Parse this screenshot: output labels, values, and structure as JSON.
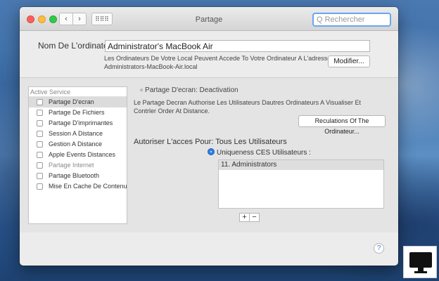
{
  "window": {
    "title": "Partage",
    "search_placeholder": "Q Rechercher"
  },
  "nav": {
    "back": "‹",
    "forward": "›",
    "grid": "⠿⠿⠿"
  },
  "computer_name": {
    "label": "Nom De L'ordinateur:",
    "value": "Administrator's MacBook Air",
    "address_line1": "Les Ordinateurs De Votre Local Peuvent Accede To Votre Ordinateur A L'adresse :",
    "address_line2": "Administrators-MacBook-Air.local",
    "modify_button": "Modifier..."
  },
  "services": {
    "header": "Active Service",
    "items": [
      {
        "label": "Partage D'ecran",
        "selected": true,
        "dim": false
      },
      {
        "label": "Partage De Fichiers",
        "selected": false,
        "dim": false
      },
      {
        "label": "Partage D'imprimantes",
        "selected": false,
        "dim": false
      },
      {
        "label": "Session A Distance",
        "selected": false,
        "dim": false
      },
      {
        "label": "Gestion A Distance",
        "selected": false,
        "dim": false
      },
      {
        "label": "Apple Events Distances",
        "selected": false,
        "dim": false
      },
      {
        "label": "Partage Internet",
        "selected": false,
        "dim": true
      },
      {
        "label": "Partage Bluetooth",
        "selected": false,
        "dim": false
      },
      {
        "label": "Mise En Cache De Contenu",
        "selected": false,
        "dim": false
      }
    ]
  },
  "detail": {
    "status": "Partage D'ecran: Deactivation",
    "description": "Le Partage Decran Authorise Les Utilisateurs Dautres Ordinateurs A Visualiser Et Contrler Order At Distance.",
    "computer_settings_button": "Reculations Of The Ordinateur...",
    "allow_access_label": "Autoriser L'acces Pour: Tous Les Utilisateurs",
    "only_these_label": "Uniqueness CES Utilisateurs :",
    "users": [
      "11. Administrators"
    ],
    "add_label": "+",
    "remove_label": "−"
  },
  "help_label": "?"
}
